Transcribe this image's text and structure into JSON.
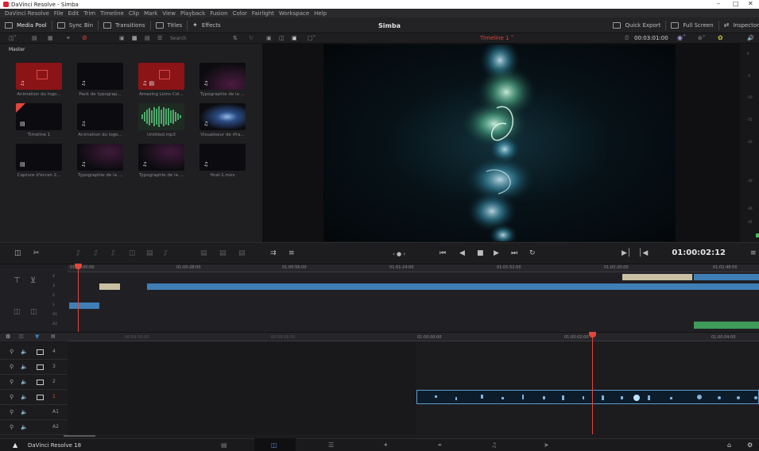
{
  "window": {
    "title": "DaVinci Resolve - Simba"
  },
  "menu": [
    "DaVinci Resolve",
    "File",
    "Edit",
    "Trim",
    "Timeline",
    "Clip",
    "Mark",
    "View",
    "Playback",
    "Fusion",
    "Color",
    "Fairlight",
    "Workspace",
    "Help"
  ],
  "toolbar": {
    "media_pool": "Media Pool",
    "sync_bin": "Sync Bin",
    "transitions": "Transitions",
    "titles": "Titles",
    "effects": "Effects",
    "project_title": "Simba",
    "quick_export": "Quick Export",
    "full_screen": "Full Screen",
    "inspector": "Inspector"
  },
  "media_pool": {
    "search_placeholder": "Search",
    "bin_label": "Master",
    "clips": [
      {
        "name": "Animation du logo..."
      },
      {
        "name": "Pack de typograp..."
      },
      {
        "name": "Amazing Lions Col..."
      },
      {
        "name": "Typographie de la ..."
      },
      {
        "name": "Timeline 1"
      },
      {
        "name": "Animation du logo..."
      },
      {
        "name": "Untitled.mp3"
      },
      {
        "name": "Visualiseur de rfra..."
      },
      {
        "name": "Capture d'écran 2..."
      },
      {
        "name": "Typographie de la ..."
      },
      {
        "name": "Typographie de la ..."
      },
      {
        "name": "final-1.mov"
      }
    ]
  },
  "viewer": {
    "timeline_name": "Timeline 1",
    "duration": "00:03:01:00",
    "timecode": "01:00:02:12"
  },
  "meter": {
    "ticks": [
      "0",
      "-5",
      "-10",
      "-15",
      "-20",
      "-30",
      "-40",
      "-45"
    ]
  },
  "upper_timeline": {
    "ruler": [
      "01:00:00:00",
      "01:00:28:00",
      "01:00:56:00",
      "01:01:24:00",
      "01:01:52:00",
      "01:02:20:00",
      "01:02:48:00"
    ],
    "tracks": [
      "4",
      "3",
      "2",
      "1",
      "A1",
      "A2"
    ]
  },
  "lower_timeline": {
    "ruler": [
      "00:59:56:00",
      "00:59:58:00",
      "01:00:00:00",
      "01:00:02:00",
      "01:00:04:00"
    ],
    "tracks": [
      "4",
      "3",
      "2",
      "1",
      "A1",
      "A2"
    ]
  },
  "footer": {
    "app_version": "DaVinci Resolve 18"
  },
  "colors": {
    "accent_red": "#e0463b",
    "video_clip": "#3f7fb6",
    "title_clip": "#c9c0a3",
    "audio_clip": "#3f9b5a"
  }
}
